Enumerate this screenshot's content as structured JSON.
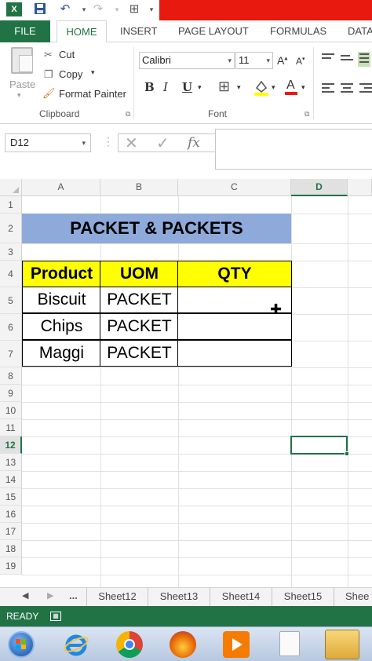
{
  "app": {
    "logo": "X"
  },
  "ribbon_tabs": [
    "FILE",
    "HOME",
    "INSERT",
    "PAGE LAYOUT",
    "FORMULAS",
    "DATA"
  ],
  "clipboard": {
    "paste": "Paste",
    "cut": "Cut",
    "copy": "Copy",
    "format_painter": "Format Painter",
    "group_label": "Clipboard"
  },
  "font": {
    "name": "Calibri",
    "size": "11",
    "group_label": "Font",
    "bold": "B",
    "italic": "I",
    "underline": "U"
  },
  "formula_bar": {
    "name_box": "D12",
    "fx": "fx",
    "value": ""
  },
  "columns": [
    "A",
    "B",
    "C",
    "D"
  ],
  "active_column": "D",
  "rows": [
    "1",
    "2",
    "3",
    "4",
    "5",
    "6",
    "7",
    "8",
    "9",
    "10",
    "11",
    "12",
    "13",
    "14",
    "15",
    "16",
    "17",
    "18",
    "19"
  ],
  "active_row": "12",
  "sheet": {
    "title": "PACKET & PACKETS",
    "headers": [
      "Product",
      "UOM",
      "QTY"
    ],
    "data": [
      [
        "Biscuit",
        "PACKET",
        ""
      ],
      [
        "Chips",
        "PACKET",
        ""
      ],
      [
        "Maggi",
        "PACKET",
        ""
      ]
    ]
  },
  "sheet_tabs": {
    "more": "...",
    "tabs": [
      "Sheet12",
      "Sheet13",
      "Sheet14",
      "Sheet15",
      "Shee"
    ]
  },
  "status": {
    "ready": "READY"
  },
  "colors": {
    "excel_green": "#217346",
    "title_fill": "#8eaadb",
    "header_fill": "#ffff00",
    "title_bar_red": "#e8190f"
  }
}
